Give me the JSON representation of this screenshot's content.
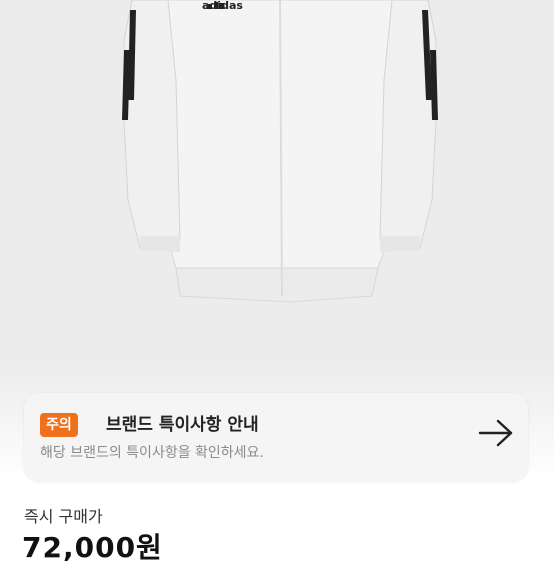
{
  "product": {
    "brand_logo_text": "adidas",
    "image_icon": "jacket-image"
  },
  "notice": {
    "badge": "주의",
    "title": "브랜드 특이사항 안내",
    "description": "해당 브랜드의 특이사항을 확인하세요.",
    "arrow_icon": "arrow-right-icon"
  },
  "purchase": {
    "label": "즉시 구매가",
    "price": "72,000원"
  },
  "colors": {
    "badge": "#f0711c",
    "hero_bg": "#ececec"
  }
}
